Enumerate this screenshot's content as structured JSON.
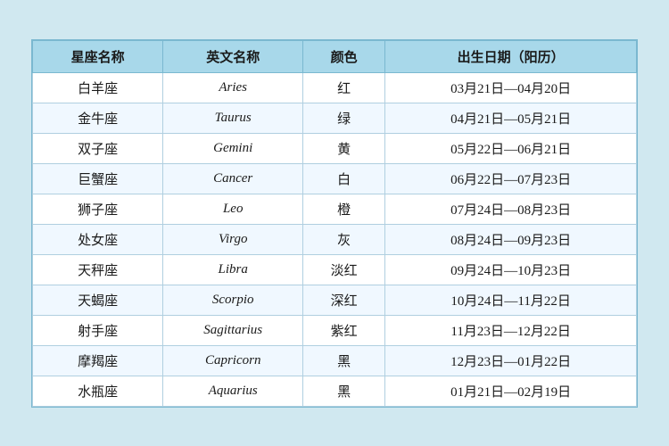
{
  "table": {
    "headers": [
      "星座名称",
      "英文名称",
      "颜色",
      "出生日期（阳历）"
    ],
    "rows": [
      {
        "chinese": "白羊座",
        "english": "Aries",
        "color": "红",
        "dates": "03月21日—04月20日"
      },
      {
        "chinese": "金牛座",
        "english": "Taurus",
        "color": "绿",
        "dates": "04月21日—05月21日"
      },
      {
        "chinese": "双子座",
        "english": "Gemini",
        "color": "黄",
        "dates": "05月22日—06月21日"
      },
      {
        "chinese": "巨蟹座",
        "english": "Cancer",
        "color": "白",
        "dates": "06月22日—07月23日"
      },
      {
        "chinese": "狮子座",
        "english": "Leo",
        "color": "橙",
        "dates": "07月24日—08月23日"
      },
      {
        "chinese": "处女座",
        "english": "Virgo",
        "color": "灰",
        "dates": "08月24日—09月23日"
      },
      {
        "chinese": "天秤座",
        "english": "Libra",
        "color": "淡红",
        "dates": "09月24日—10月23日"
      },
      {
        "chinese": "天蝎座",
        "english": "Scorpio",
        "color": "深红",
        "dates": "10月24日—11月22日"
      },
      {
        "chinese": "射手座",
        "english": "Sagittarius",
        "color": "紫红",
        "dates": "11月23日—12月22日"
      },
      {
        "chinese": "摩羯座",
        "english": "Capricorn",
        "color": "黑",
        "dates": "12月23日—01月22日"
      },
      {
        "chinese": "水瓶座",
        "english": "Aquarius",
        "color": "黑",
        "dates": "01月21日—02月19日"
      }
    ]
  }
}
